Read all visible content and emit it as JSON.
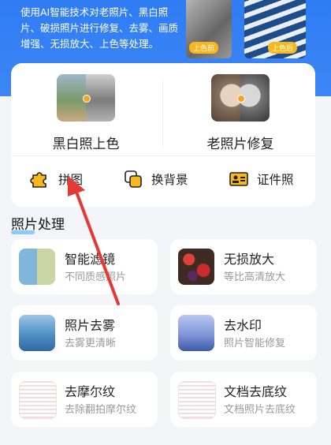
{
  "hero": {
    "description": "使用AI智能技术对老照片、黑白照片、破损照片进行修复、去雾、画质增强、无损放大、上色等处理。",
    "badge_left": "上色前",
    "badge_right": "上色后"
  },
  "main_features": [
    {
      "label": "黑白照上色"
    },
    {
      "label": "老照片修复"
    }
  ],
  "mini_features": [
    {
      "label": "拼图",
      "icon": "puzzle-icon"
    },
    {
      "label": "换背景",
      "icon": "layers-icon"
    },
    {
      "label": "证件照",
      "icon": "id-card-icon"
    }
  ],
  "section": {
    "title": "照片处理"
  },
  "tools": [
    {
      "title": "智能滤镜",
      "subtitle": "不同质感照片"
    },
    {
      "title": "无损放大",
      "subtitle": "等比高清放大"
    },
    {
      "title": "照片去雾",
      "subtitle": "去雾更清晰"
    },
    {
      "title": "去水印",
      "subtitle": "照片智能修复"
    },
    {
      "title": "去摩尔纹",
      "subtitle": "去除翻拍摩尔纹"
    },
    {
      "title": "文档去底纹",
      "subtitle": "文档照片去底纹"
    }
  ],
  "colors": {
    "hero_blue": "#3c86f5",
    "accent_yellow": "#f6b81c",
    "arrow_red": "#e53935"
  }
}
